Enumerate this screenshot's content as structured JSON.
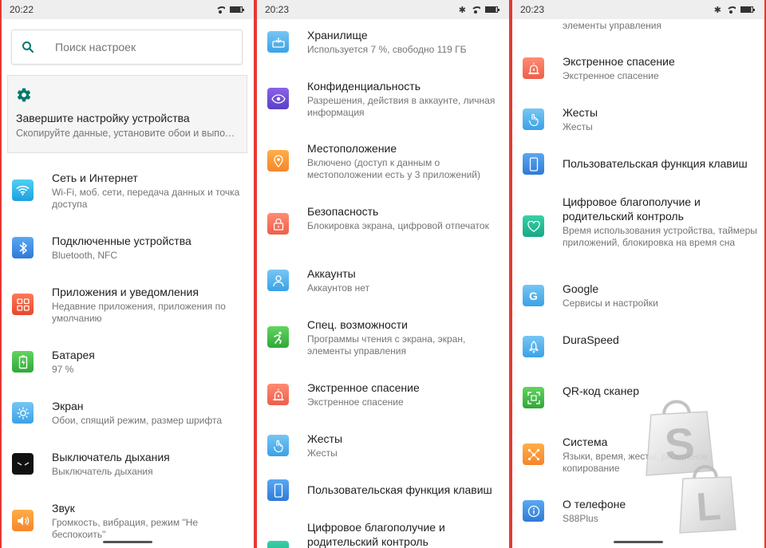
{
  "panel1": {
    "status_time": "20:22",
    "search_placeholder": "Поиск настроек",
    "setup_card": {
      "title": "Завершите настройку устройства",
      "subtitle": "Скопируйте данные, установите обои и выполн..."
    },
    "items": [
      {
        "title": "Сеть и Интернет",
        "subtitle": "Wi-Fi, моб. сети, передача данных и точка доступа",
        "icon": "wifi-icon"
      },
      {
        "title": "Подключенные устройства",
        "subtitle": "Bluetooth, NFC",
        "icon": "bluetooth-icon"
      },
      {
        "title": "Приложения и уведомления",
        "subtitle": "Недавние приложения, приложения по умолчанию",
        "icon": "apps-icon"
      },
      {
        "title": "Батарея",
        "subtitle": "97 %",
        "icon": "battery-icon"
      },
      {
        "title": "Экран",
        "subtitle": "Обои, спящий режим, размер шрифта",
        "icon": "display-icon"
      },
      {
        "title": "Выключатель дыхания",
        "subtitle": "Выключатель дыхания",
        "icon": "breathing-light-icon"
      },
      {
        "title": "Звук",
        "subtitle": "Громкость, вибрация, режим \"Не беспокоить\"",
        "icon": "sound-icon"
      }
    ]
  },
  "panel2": {
    "status_time": "20:23",
    "items": [
      {
        "title": "Хранилище",
        "subtitle": "Используется 7 %, свободно 119 ГБ",
        "icon": "storage-icon"
      },
      {
        "title": "Конфиденциальность",
        "subtitle": "Разрешения, действия в аккаунте, личная информация",
        "icon": "privacy-icon"
      },
      {
        "title": "Местоположение",
        "subtitle": "Включено (доступ к данным о местоположении есть у 3 приложений)",
        "icon": "location-icon"
      },
      {
        "title": "Безопасность",
        "subtitle": "Блокировка экрана, цифровой отпечаток",
        "icon": "security-icon"
      },
      {
        "title": "Аккаунты",
        "subtitle": "Аккаунтов нет",
        "icon": "accounts-icon"
      },
      {
        "title": "Спец. возможности",
        "subtitle": "Программы чтения с экрана, экран, элементы управления",
        "icon": "accessibility-icon"
      },
      {
        "title": "Экстренное спасение",
        "subtitle": "Экстренное спасение",
        "icon": "emergency-icon"
      },
      {
        "title": "Жесты",
        "subtitle": "Жесты",
        "icon": "gestures-icon"
      },
      {
        "title": "Пользовательская функция клавиш",
        "subtitle": "",
        "icon": "custom-keys-icon"
      },
      {
        "title": "Цифровое благополучие и родительский контроль",
        "subtitle": "",
        "icon": "wellbeing-icon"
      }
    ]
  },
  "panel3": {
    "status_time": "20:23",
    "top_fragment": "элементы управления",
    "items": [
      {
        "title": "Экстренное спасение",
        "subtitle": "Экстренное спасение",
        "icon": "emergency-icon"
      },
      {
        "title": "Жесты",
        "subtitle": "Жесты",
        "icon": "gestures-icon"
      },
      {
        "title": "Пользовательская функция клавиш",
        "subtitle": "",
        "icon": "custom-keys-icon"
      },
      {
        "title": "Цифровое благополучие и родительский контроль",
        "subtitle": "Время использования устройства, таймеры приложений, блокировка на время сна",
        "icon": "wellbeing-icon"
      },
      {
        "title": "Google",
        "subtitle": "Сервисы и настройки",
        "icon": "google-icon"
      },
      {
        "title": "DuraSpeed",
        "subtitle": "",
        "icon": "duraspeed-icon"
      },
      {
        "title": "QR-код сканер",
        "subtitle": "",
        "icon": "qr-scanner-icon"
      },
      {
        "title": "Система",
        "subtitle": "Языки, время, жесты, резервное копирование",
        "icon": "system-icon"
      },
      {
        "title": "О телефоне",
        "subtitle": "S88Plus",
        "icon": "about-phone-icon"
      }
    ]
  },
  "watermark": {
    "letters": [
      "S",
      "L"
    ]
  },
  "colors": {
    "border": "#e53935",
    "status_bar": "#eeeeee",
    "accent": "#00796b"
  }
}
